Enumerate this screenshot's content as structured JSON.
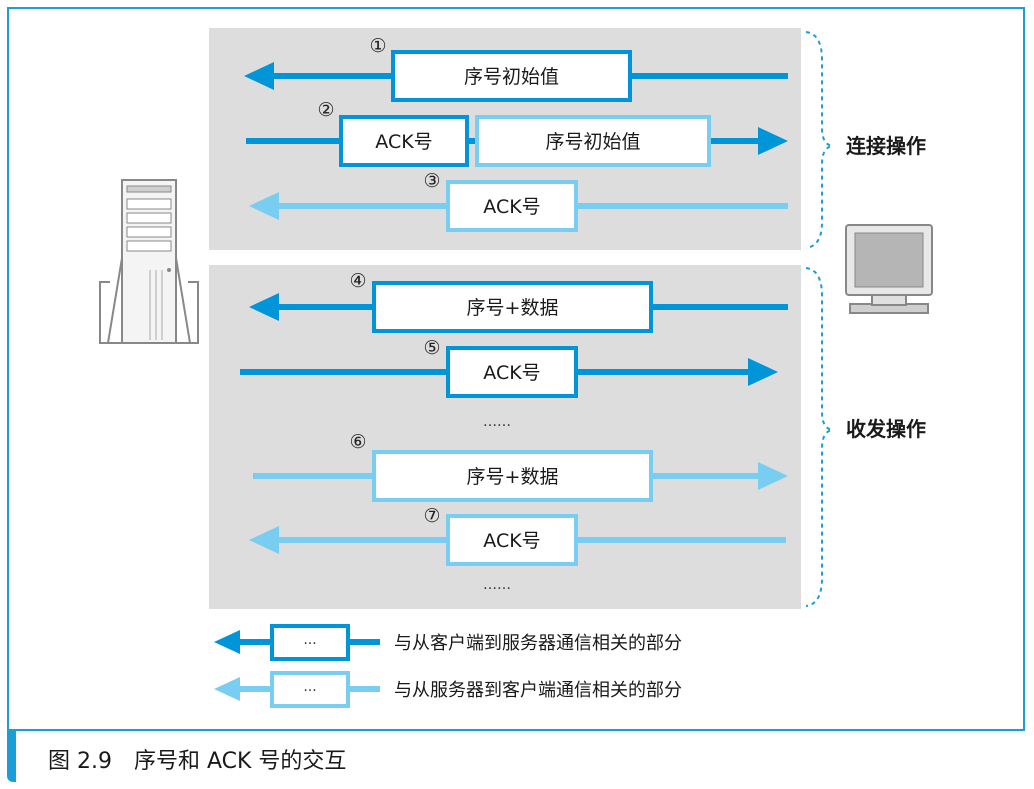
{
  "colors": {
    "dark_blue": "#0094d8",
    "light_blue": "#79cdf0",
    "panel_gray": "#dddddd",
    "frame_blue": "#1b9ed8"
  },
  "icons": {
    "server": "server-tower-icon",
    "client": "client-monitor-icon"
  },
  "sections": {
    "connect_label": "连接操作",
    "transfer_label": "收发操作"
  },
  "messages": [
    {
      "num": "①",
      "direction": "server-to-client",
      "shade": "dark",
      "boxes": [
        "序号初始值"
      ]
    },
    {
      "num": "②",
      "direction": "client-to-server",
      "shade": "mixed",
      "boxes": [
        "ACK号",
        "序号初始值"
      ]
    },
    {
      "num": "③",
      "direction": "server-to-client",
      "shade": "light",
      "boxes": [
        "ACK号"
      ]
    },
    {
      "num": "④",
      "direction": "server-to-client",
      "shade": "dark",
      "boxes": [
        "序号+数据"
      ]
    },
    {
      "num": "⑤",
      "direction": "client-to-server",
      "shade": "dark",
      "boxes": [
        "ACK号"
      ]
    },
    {
      "num": "⑥",
      "direction": "client-to-server",
      "shade": "light",
      "boxes": [
        "序号+数据"
      ]
    },
    {
      "num": "⑦",
      "direction": "server-to-client",
      "shade": "light",
      "boxes": [
        "ACK号"
      ]
    }
  ],
  "ellipsis": "……",
  "legend": [
    {
      "box_text": "···",
      "shade": "dark",
      "label": "与从客户端到服务器通信相关的部分"
    },
    {
      "box_text": "···",
      "shade": "light",
      "label": "与从服务器到客户端通信相关的部分"
    }
  ],
  "caption": {
    "number": "图 2.9",
    "title": "序号和 ACK 号的交互"
  }
}
